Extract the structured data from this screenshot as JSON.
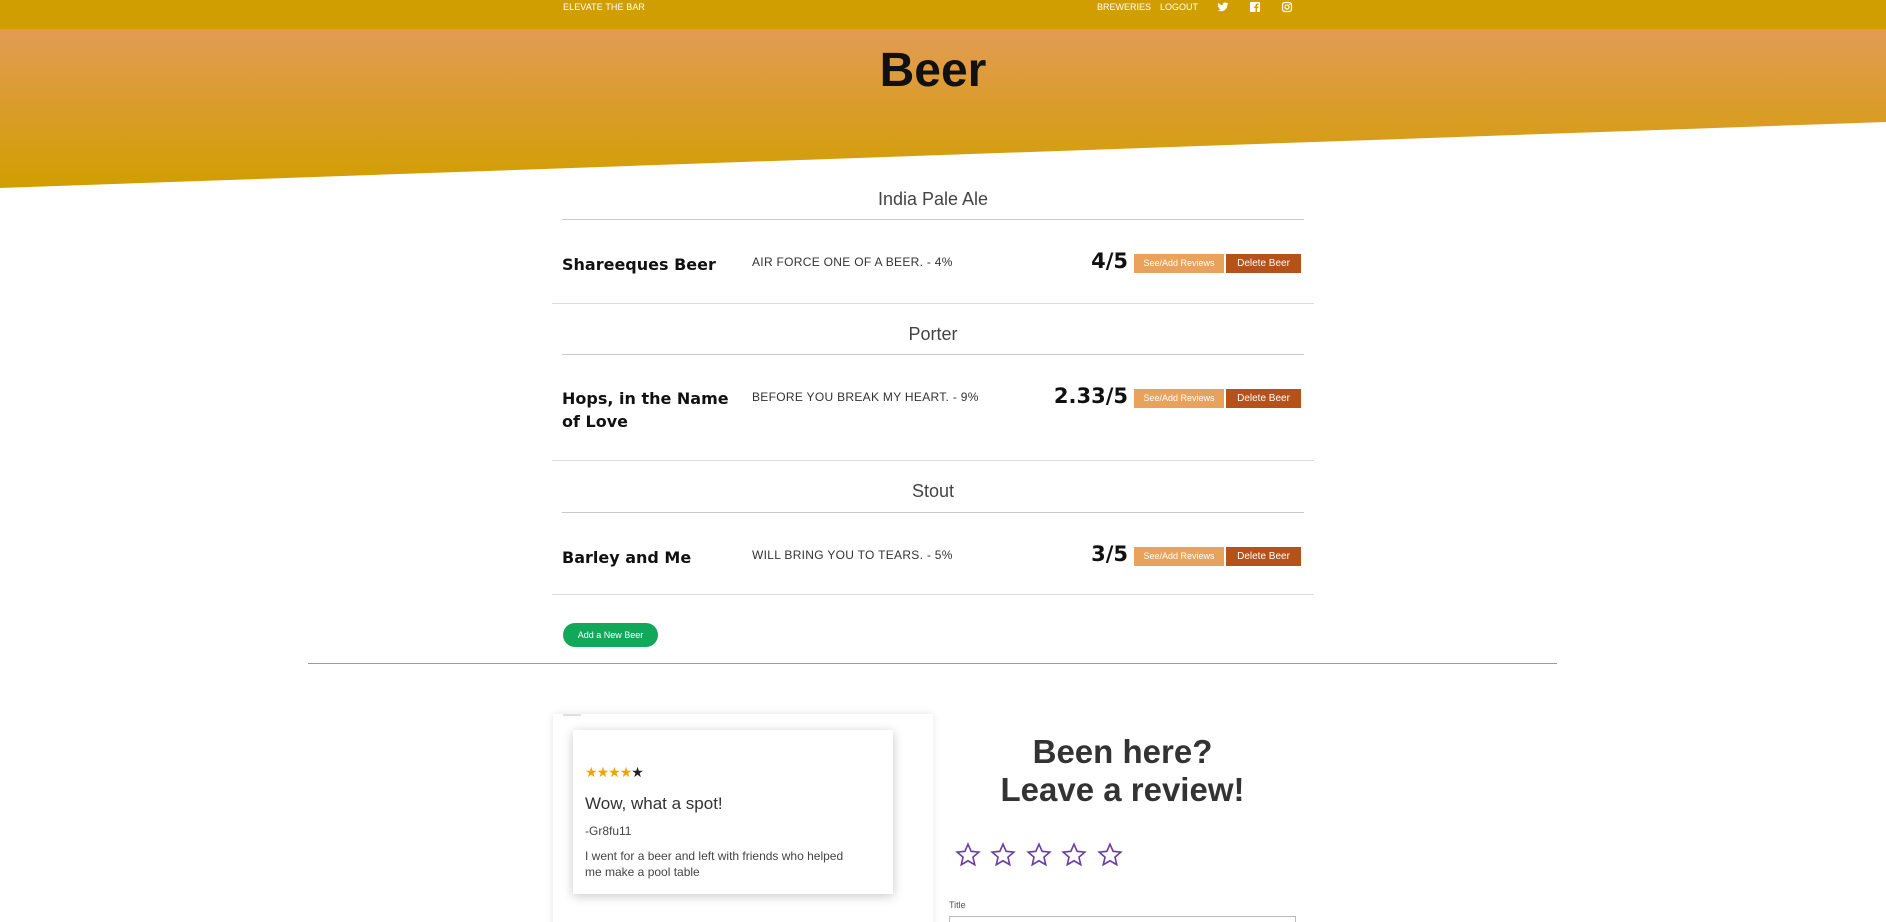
{
  "nav": {
    "brand": "ELEVATE THE BAR",
    "breweries": "BREWERIES",
    "logout": "LOGOUT",
    "icons": [
      "twitter-icon",
      "facebook-icon",
      "instagram-icon"
    ]
  },
  "hero": {
    "title": "Beer"
  },
  "categories": [
    {
      "name": "India Pale Ale",
      "beers": [
        {
          "name": "Shareeques Beer",
          "description": "AIR FORCE ONE OF A BEER. - 4%",
          "rating": "4/5"
        }
      ]
    },
    {
      "name": "Porter",
      "beers": [
        {
          "name": "Hops, in the Name of Love",
          "description": "BEFORE YOU BREAK MY HEART. - 9%",
          "rating": "2.33/5"
        }
      ]
    },
    {
      "name": "Stout",
      "beers": [
        {
          "name": "Barley and Me",
          "description": "WILL BRING YOU TO TEARS. - 5%",
          "rating": "3/5"
        }
      ]
    }
  ],
  "buttons": {
    "reviews": "See/Add Reviews",
    "delete": "Delete Beer",
    "add": "Add a New Beer"
  },
  "review_card": {
    "stars_filled": 4,
    "stars_total": 5,
    "title": "Wow, what a spot!",
    "user": "-Gr8fu11",
    "text": "I went for a beer and left with friends who helped me make a pool table"
  },
  "review_form": {
    "heading_line1": "Been here?",
    "heading_line2": "Leave a review!",
    "stars_total": 5,
    "title_label": "Title",
    "title_value": ""
  },
  "colors": {
    "topbar": "#d19e00",
    "hero_top": "#e39b54",
    "hero_bottom": "#d19e00",
    "review_button": "#e8a25b",
    "delete_button": "#b5521a",
    "add_button": "#12a85a",
    "star_outline": "#6a3fa0",
    "star_filled": "#f0a400"
  }
}
